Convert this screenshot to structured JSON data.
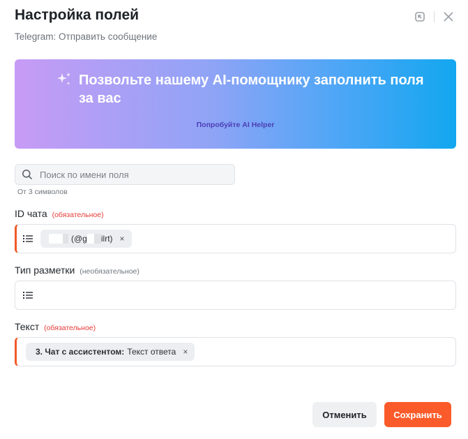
{
  "modal": {
    "title": "Настройка полей",
    "subtitle": "Telegram: Отправить сообщение"
  },
  "header_icons": {
    "restore": "window-restore-icon",
    "close": "close-icon"
  },
  "ai_banner": {
    "headline": "Позвольте нашему AI-помощнику заполнить поля за вас",
    "link": "Попробуйте AI Helper",
    "icon": "sparkles-icon"
  },
  "search": {
    "placeholder": "Поиск по имени поля",
    "value": "",
    "hint": "От 3 символов"
  },
  "fields": [
    {
      "label": "ID чата",
      "tag": "(обязательное)",
      "required": true,
      "chip": {
        "prefix": "(@g",
        "suffix": "ilrt)"
      }
    },
    {
      "label": "Тип разметки",
      "tag": "(необязательное)",
      "required": false
    },
    {
      "label": "Текст",
      "tag": "(обязательное)",
      "required": true,
      "chip": {
        "bold": "3. Чат с ассистентом:",
        "text": "Текст ответа"
      }
    }
  ],
  "chip_remove": "×",
  "buttons": {
    "cancel": "Отменить",
    "save": "Сохранить"
  },
  "colors": {
    "accent": "#fb5b2a",
    "required_marker": "#ee5a2a",
    "required_text": "#e53935",
    "banner_start": "#c79bf5",
    "banner_end": "#12a7ef"
  }
}
